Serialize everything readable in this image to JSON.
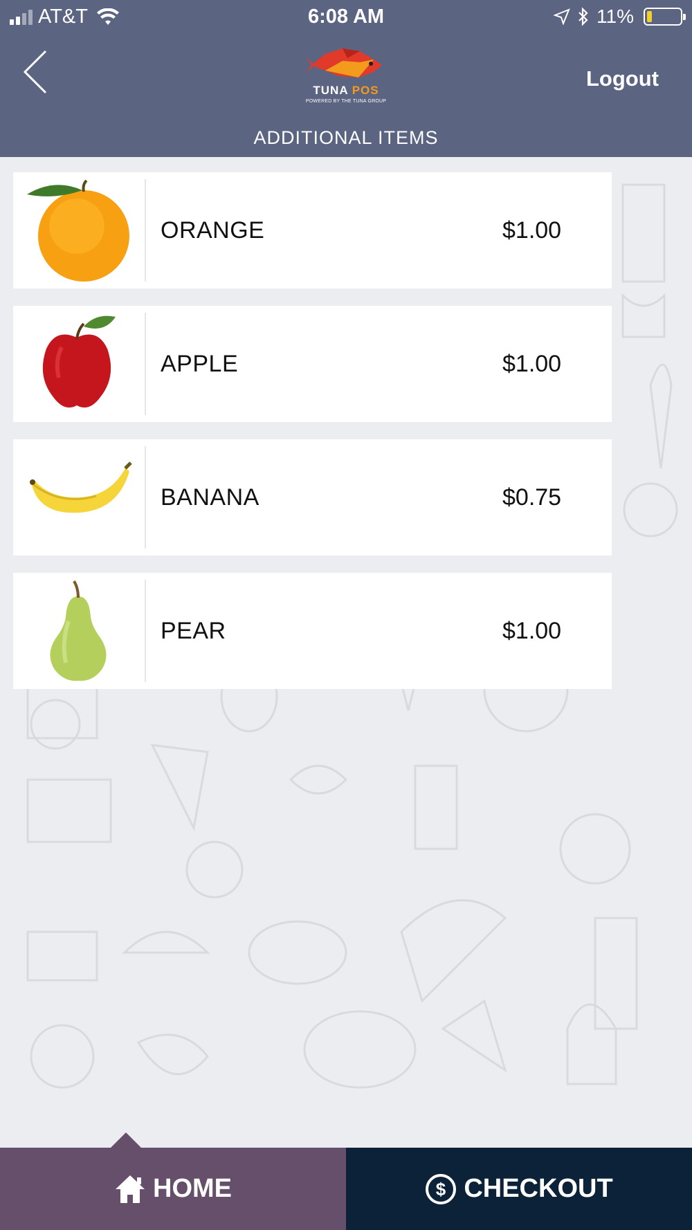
{
  "status_bar": {
    "carrier": "AT&T",
    "time": "6:08 AM",
    "battery": "11%",
    "battery_level": 0.11
  },
  "header": {
    "logo_name_main": "TUNA",
    "logo_name_accent": "POS",
    "logo_tagline": "POWERED BY THE TUNA GROUP",
    "logout_label": "Logout",
    "title": "ADDITIONAL ITEMS"
  },
  "items": [
    {
      "name": "ORANGE",
      "price": "$1.00",
      "icon": "orange-fruit"
    },
    {
      "name": "APPLE",
      "price": "$1.00",
      "icon": "apple-fruit"
    },
    {
      "name": "BANANA",
      "price": "$0.75",
      "icon": "banana-fruit"
    },
    {
      "name": "PEAR",
      "price": "$1.00",
      "icon": "pear-fruit"
    }
  ],
  "bottom_nav": {
    "home_label": "HOME",
    "checkout_label": "CHECKOUT",
    "active": "home"
  },
  "colors": {
    "header_bg": "#5b6480",
    "home_bg": "#654f6b",
    "checkout_bg": "#0b2239",
    "logo_accent": "#f29b1d",
    "battery_fill": "#f2cf2e"
  }
}
